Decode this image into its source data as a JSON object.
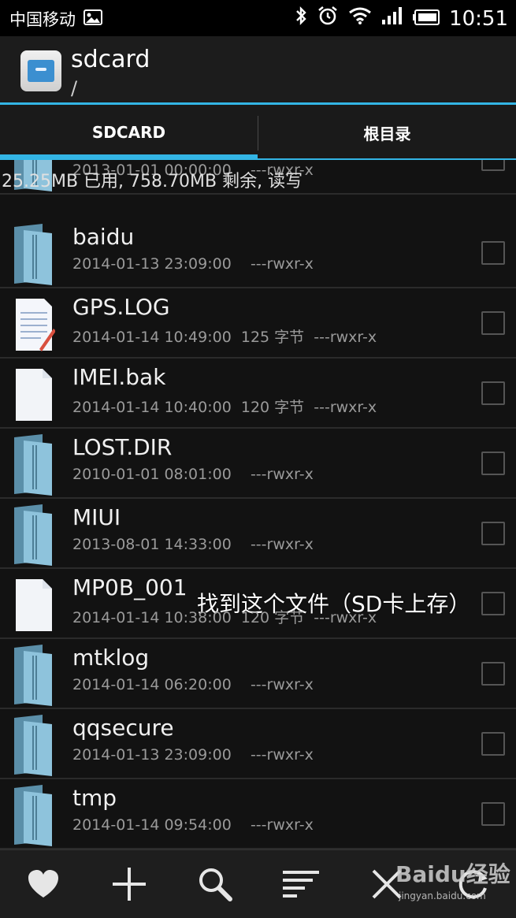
{
  "status_bar": {
    "carrier": "中国移动",
    "time": "10:51",
    "icons": [
      "image-icon",
      "bluetooth-icon",
      "alarm-icon",
      "wifi-icon",
      "signal-icon",
      "battery-icon"
    ]
  },
  "action_bar": {
    "title": "sdcard",
    "path": "/",
    "accent_color": "#33b5e5"
  },
  "tabs": [
    {
      "label": "SDCARD",
      "selected": true
    },
    {
      "label": "根目录",
      "selected": false
    }
  ],
  "storage_info": "25.25MB 已用, 758.70MB 剩余, 读写",
  "files": [
    {
      "name": "",
      "meta": "2013-01-01 00:00:00    ---rwxr-x",
      "type": "folder"
    },
    {
      "name": "baidu",
      "meta": "2014-01-13 23:09:00    ---rwxr-x",
      "type": "folder"
    },
    {
      "name": "GPS.LOG",
      "meta": "2014-01-14 10:49:00  125 字节  ---rwxr-x",
      "type": "text"
    },
    {
      "name": "IMEI.bak",
      "meta": "2014-01-14 10:40:00  120 字节  ---rwxr-x",
      "type": "file"
    },
    {
      "name": "LOST.DIR",
      "meta": "2010-01-01 08:01:00    ---rwxr-x",
      "type": "folder"
    },
    {
      "name": "MIUI",
      "meta": "2013-08-01 14:33:00    ---rwxr-x",
      "type": "folder"
    },
    {
      "name": "MP0B_001",
      "meta": "2014-01-14 10:38:00  120 字节  ---rwxr-x",
      "type": "file"
    },
    {
      "name": "mtklog",
      "meta": "2014-01-14 06:20:00    ---rwxr-x",
      "type": "folder"
    },
    {
      "name": "qqsecure",
      "meta": "2014-01-13 23:09:00    ---rwxr-x",
      "type": "folder"
    },
    {
      "name": "tmp",
      "meta": "2014-01-14 09:54:00    ---rwxr-x",
      "type": "folder"
    }
  ],
  "annotation": "找到这个文件（SD卡上存）",
  "bottom_bar": [
    "heart-icon",
    "plus-icon",
    "search-icon",
    "sort-icon",
    "close-icon",
    "refresh-icon"
  ],
  "watermark": {
    "text": "Baidu经验",
    "sub": "jingyan.baidu.com"
  }
}
